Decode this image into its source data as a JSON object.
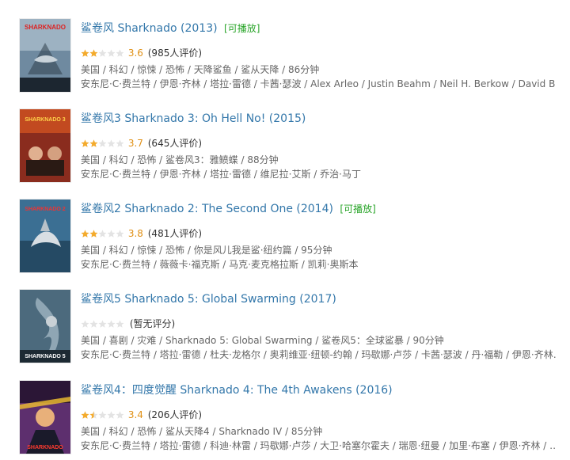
{
  "results": [
    {
      "title": "鲨卷风 Sharknado (2013)",
      "playable": "[可播放]",
      "stars": 2,
      "half": false,
      "score": "3.6",
      "votes": "(985人评价)",
      "genres": "美国 / 科幻 / 惊悚 / 恐怖 / 天降鲨鱼 / 鲨从天降 / 86分钟",
      "cast": "安东尼·C·费兰特 / 伊恩·齐林 / 塔拉·雷德 / 卡茜·瑟波 / Alex Arleo / Justin Beahm / Neil H. Berkow / David Bittic…",
      "poster_title": "SHARKNADO",
      "poster_color": "#6f8aa0"
    },
    {
      "title": "鲨卷风3 Sharknado 3: Oh Hell No! (2015)",
      "playable": "",
      "stars": 2,
      "half": false,
      "score": "3.7",
      "votes": "(645人评价)",
      "genres": "美国 / 科幻 / 恐怖 / 鲨卷风3：雅鲼蝶 / 88分钟",
      "cast": "安东尼·C·费兰特 / 伊恩·齐林 / 塔拉·雷德 / 维尼拉·艾斯 / 乔治·马丁",
      "poster_title": "SHARKNADO 3",
      "poster_color": "#8a2c1e"
    },
    {
      "title": "鲨卷风2 Sharknado 2: The Second One (2014)",
      "playable": "[可播放]",
      "stars": 2,
      "half": false,
      "score": "3.8",
      "votes": "(481人评价)",
      "genres": "美国 / 科幻 / 惊悚 / 恐怖 / 你是风儿我是鲨·纽约篇 / 95分钟",
      "cast": "安东尼·C·费兰特 / 薇薇卡·福克斯 / 马克·麦克格拉斯 / 凯莉·奥斯本",
      "poster_title": "SHARKNADO 2",
      "poster_color": "#3b6f93"
    },
    {
      "title": "鲨卷风5 Sharknado 5: Global Swarming (2017)",
      "playable": "",
      "stars": 0,
      "half": false,
      "score": "",
      "votes": "(暂无评分)",
      "genres": "美国 / 喜剧 / 灾难 / Sharknado 5: Global Swarming / 鲨卷风5：全球鲨暴 / 90分钟",
      "cast": "安东尼·C·费兰特 / 塔拉·雷德 / 杜夫·龙格尔 / 奥莉维亚·纽顿-约翰 / 玛歇娜·卢莎 / 卡茜·瑟波 / 丹·福勒 / 伊恩·齐林…",
      "poster_title": "SHARKNADO 5",
      "poster_color": "#4c6a7d"
    },
    {
      "title": "鲨卷风4：四度觉醒 Sharknado 4: The 4th Awakens (2016)",
      "playable": "",
      "stars": 1,
      "half": true,
      "score": "3.4",
      "votes": "(206人评价)",
      "genres": "美国 / 科幻 / 恐怖 / 鲨从天降4 / Sharknado IV / 85分钟",
      "cast": "安东尼·C·费兰特 / 塔拉·雷德 / 科迪·林雷 / 玛歇娜·卢莎 / 大卫·哈塞尔霍夫 / 瑞恩·纽曼 / 加里·布塞 / 伊恩·齐林 / …",
      "poster_title": "SHARKNADO",
      "poster_color": "#5d2f6e"
    }
  ]
}
